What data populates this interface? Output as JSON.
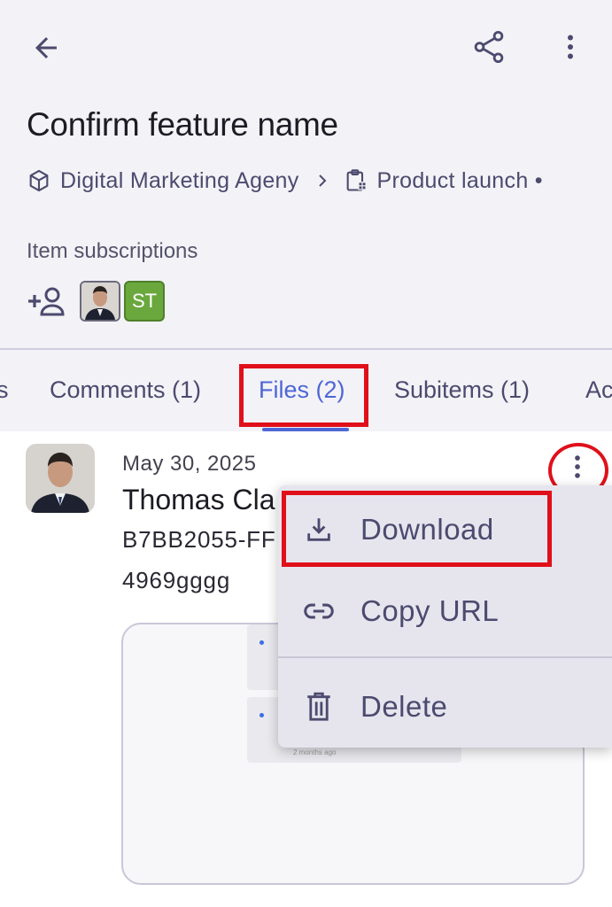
{
  "header": {
    "title": "Confirm feature name",
    "breadcrumb": {
      "workspace": "Digital Marketing Ageny",
      "board": "Product launch •"
    },
    "subscriptions_label": "Item subscriptions",
    "subscriber_initials": "ST"
  },
  "tabs": [
    {
      "label": "s"
    },
    {
      "label": "Comments (1)"
    },
    {
      "label": "Files (2)"
    },
    {
      "label": "Subitems (1)"
    },
    {
      "label": "Ac"
    }
  ],
  "file": {
    "date": "May 30, 2025",
    "uploader": "Thomas Cla",
    "id_line1": "B7BB2055-FF",
    "id_line2": "4969gggg",
    "preview_ago": "2 months ago"
  },
  "menu": {
    "download": "Download",
    "copy_url": "Copy URL",
    "delete": "Delete"
  },
  "colors": {
    "accent": "#4e67d6",
    "highlight": "#e0101a",
    "avatar_green": "#6aa83e"
  }
}
